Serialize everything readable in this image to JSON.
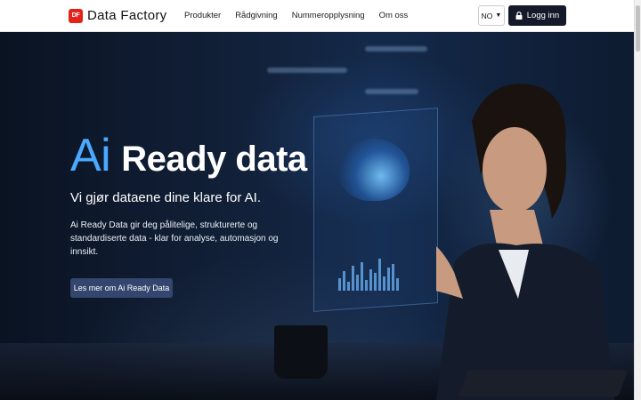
{
  "header": {
    "logo_mark": "DF",
    "logo_text": "Data Factory",
    "nav": [
      {
        "label": "Produkter"
      },
      {
        "label": "Rådgivning"
      },
      {
        "label": "Nummeropplysning"
      },
      {
        "label": "Om oss"
      }
    ],
    "language": "NO",
    "login_label": "Logg inn"
  },
  "hero": {
    "title_ai": "Ai",
    "title_rest": "Ready data",
    "subtitle": "Vi gjør dataene dine klare for AI.",
    "description": "Ai Ready Data gir deg pålitelige, strukturerte og standardiserte data - klar for analyse, automasjon og innsikt.",
    "cta_label": "Les mer om Ai Ready Data"
  },
  "colors": {
    "brand_red": "#e2231a",
    "accent_blue": "#4aa8ff",
    "login_bg": "#141a2a",
    "cta_bg": "#34456e"
  },
  "icons": {
    "logo": "data-factory-logo",
    "language_caret": "chevron-down-icon",
    "login": "lock-icon"
  }
}
